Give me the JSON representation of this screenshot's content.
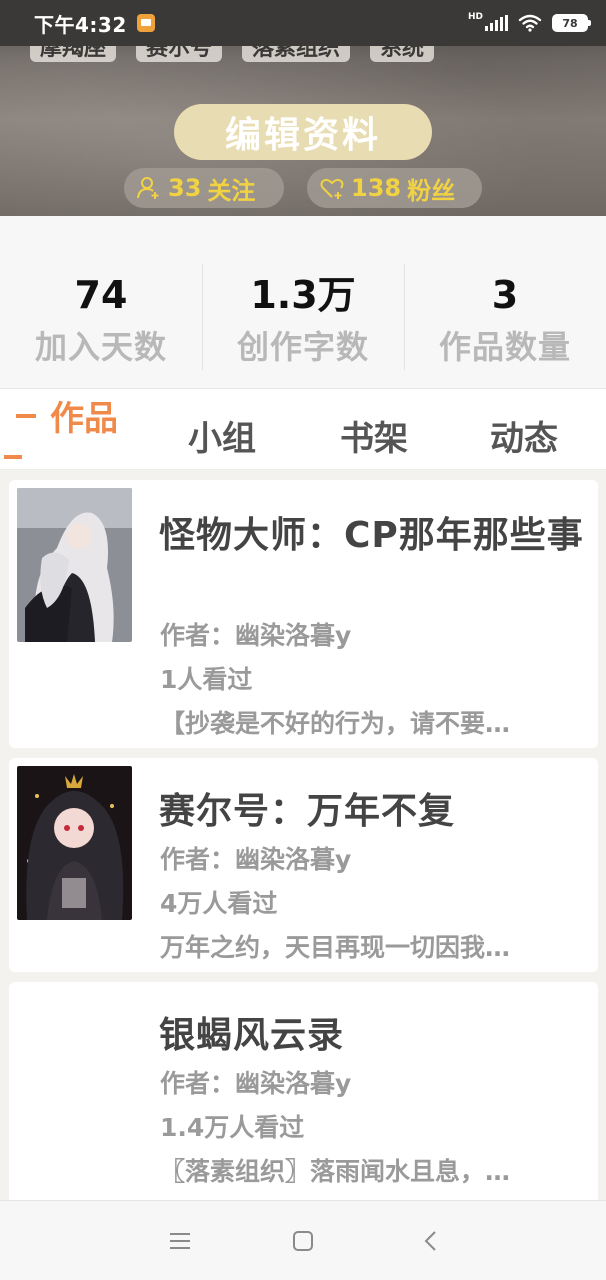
{
  "status_bar": {
    "time": "下午4:32",
    "hd_label": "HD",
    "battery": "78",
    "icons": [
      "notification-icon",
      "signal-icon",
      "wifi-icon",
      "battery-icon"
    ]
  },
  "profile": {
    "tags": [
      "摩羯座",
      "赛尔号",
      "落素组织",
      "系统"
    ],
    "edit_button": "编辑资料",
    "follow_count": "33",
    "follow_label": "关注",
    "fans_count": "138",
    "fans_label": "粉丝"
  },
  "stats": [
    {
      "value": "74",
      "label": "加入天数"
    },
    {
      "value": "1.3万",
      "label": "创作字数"
    },
    {
      "value": "3",
      "label": "作品数量"
    }
  ],
  "tabs": {
    "active": "作品",
    "items": [
      "小组",
      "书架",
      "动态"
    ]
  },
  "works": [
    {
      "title": "怪物大师：CP那年那些事",
      "author": "作者：幽染洛暮y",
      "views": "1人看过",
      "summary": "【抄袭是不好的行为，请不要…"
    },
    {
      "title": "赛尔号：万年不复",
      "author": "作者：幽染洛暮y",
      "views": "4万人看过",
      "summary": "万年之约，天目再现一切因我…"
    },
    {
      "title": "银蝎风云录",
      "author": "作者：幽染洛暮y",
      "views": "1.4万人看过",
      "summary": "〖落素组织〗落雨闻水且息，…"
    }
  ],
  "colors": {
    "accent": "#f08a4b",
    "pill_text": "#f1d243",
    "edit_button_bg": "#e8dcb3"
  }
}
